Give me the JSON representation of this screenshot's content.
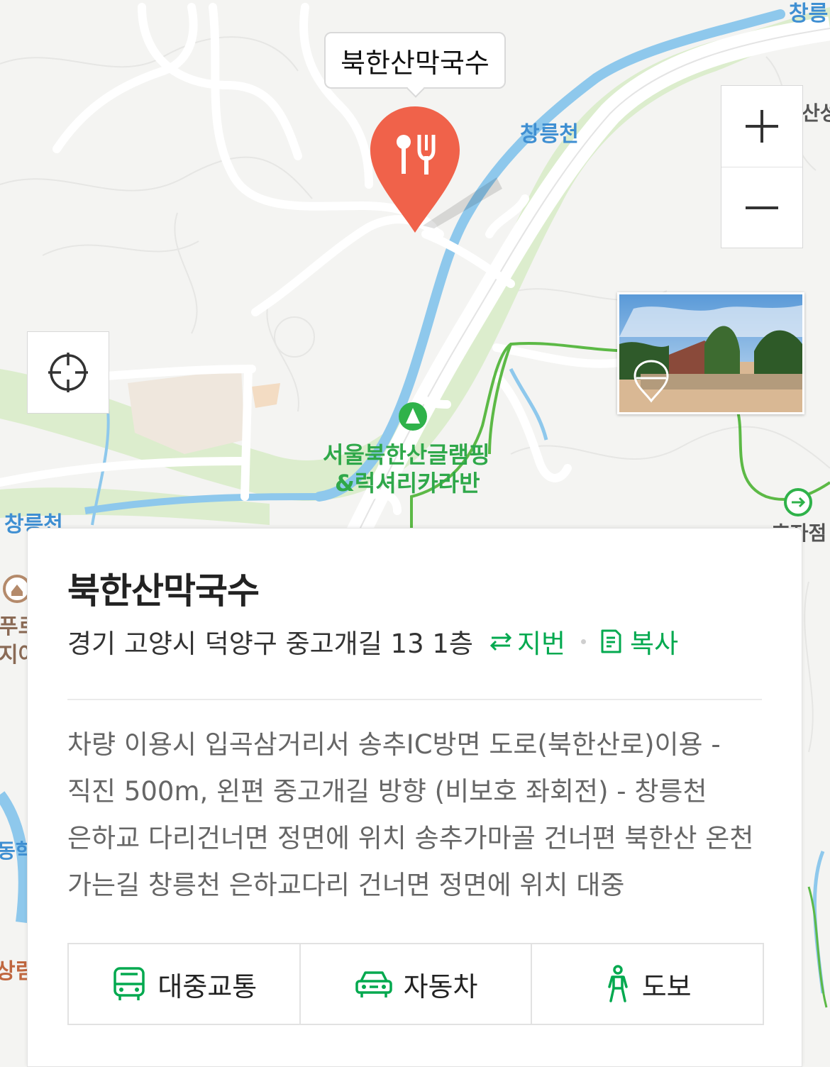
{
  "map": {
    "selected_place_tooltip": "북한산막국수",
    "labels": {
      "stream_top_right": "창릉",
      "stream_center": "창릉천",
      "stream_left": "창릉천",
      "sanseong_fragment": "산성",
      "campsite_line1": "서울북한산글램핑",
      "campsite_line2": "&럭셔리카라반",
      "store_fragment": "효자점",
      "left_fragment_1": "푸르",
      "left_fragment_2": "지어",
      "left_fragment_3": "동학",
      "left_fragment_4": "상림"
    },
    "controls": {
      "zoom_in": "+",
      "zoom_out": "−"
    }
  },
  "place": {
    "name": "북한산막국수",
    "address": "경기 고양시 덕양구 중고개길 13 1층",
    "jibun_label": "지번",
    "copy_label": "복사",
    "description": "차량 이용시 입곡삼거리서 송추IC방면 도로(북한산로)이용 - 직진 500m, 왼편 중고개길 방향 (비보호 좌회전) - 창릉천 은하교 다리건너면 정면에 위치 송추가마골 건너편 북한산 온천 가는길 창릉천 은하교다리 건너면 정면에 위치 대중"
  },
  "route_buttons": [
    {
      "label": "대중교통",
      "icon": "bus-icon"
    },
    {
      "label": "자동차",
      "icon": "car-icon"
    },
    {
      "label": "도보",
      "icon": "walk-icon"
    }
  ],
  "colors": {
    "accent_green": "#03a94f",
    "pin_red": "#f0624a",
    "water_blue": "#8ec8ec",
    "park_green": "#d9ecc7",
    "trail_green": "#5cb946"
  }
}
